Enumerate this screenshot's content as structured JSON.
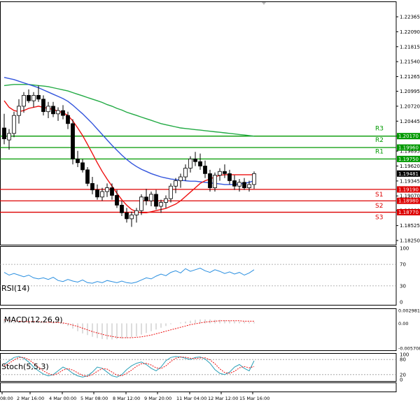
{
  "chart_data": {
    "type": "candlestick",
    "main": {
      "price_axis_ticks": [
        "1.22365",
        "1.22090",
        "1.21815",
        "1.21540",
        "1.21265",
        "1.20995",
        "1.20720",
        "1.20445",
        "1.20170",
        "1.19895",
        "1.19620",
        "1.19345",
        "1.19070",
        "1.18800",
        "1.18525",
        "1.18250"
      ],
      "x_ticks": [
        "08:00",
        "2 Mar 16:00",
        "4 Mar 00:00",
        "5 Mar 08:00",
        "8 Mar 12:00",
        "9 Mar 20:00",
        "11 Mar 04:00",
        "12 Mar 12:00",
        "15 Mar 16:00"
      ],
      "current_price": "1.19481",
      "levels": [
        {
          "name": "R3",
          "value": 1.2017,
          "label": "1.20170",
          "color": "#009900"
        },
        {
          "name": "R2",
          "value": 1.1996,
          "label": "1.19960",
          "color": "#009900"
        },
        {
          "name": "R1",
          "value": 1.1975,
          "label": "1.19750",
          "color": "#009900"
        },
        {
          "name": "S1",
          "value": 1.1919,
          "label": "1.19190",
          "color": "#dd0000"
        },
        {
          "name": "S2",
          "value": 1.1898,
          "label": "1.18980",
          "color": "#dd0000"
        },
        {
          "name": "S3",
          "value": 1.1877,
          "label": "1.18770",
          "color": "#dd0000"
        }
      ],
      "candles": [
        [
          1.2032,
          1.2058,
          1.2002,
          1.2012
        ],
        [
          1.201,
          1.203,
          1.1992,
          1.2022
        ],
        [
          1.2022,
          1.2062,
          1.2015,
          1.2055
        ],
        [
          1.2055,
          1.2085,
          1.204,
          1.2072
        ],
        [
          1.2072,
          1.2098,
          1.206,
          1.2092
        ],
        [
          1.2092,
          1.2103,
          1.2078,
          1.2082
        ],
        [
          1.2082,
          1.2098,
          1.207,
          1.2092
        ],
        [
          1.2092,
          1.211,
          1.208,
          1.2085
        ],
        [
          1.2085,
          1.2092,
          1.2055,
          1.2062
        ],
        [
          1.2062,
          1.208,
          1.205,
          1.2072
        ],
        [
          1.2072,
          1.208,
          1.2052,
          1.2058
        ],
        [
          1.2058,
          1.207,
          1.2045,
          1.2064
        ],
        [
          1.2064,
          1.2074,
          1.2048,
          1.2055
        ],
        [
          1.2055,
          1.2062,
          1.203,
          1.204
        ],
        [
          1.204,
          1.2048,
          1.1965,
          1.1975
        ],
        [
          1.1975,
          1.199,
          1.196,
          1.1968
        ],
        [
          1.1968,
          1.1975,
          1.195,
          1.1955
        ],
        [
          1.1955,
          1.196,
          1.1925,
          1.193
        ],
        [
          1.193,
          1.1942,
          1.191,
          1.1918
        ],
        [
          1.1918,
          1.1928,
          1.19,
          1.1905
        ],
        [
          1.1905,
          1.1922,
          1.1898,
          1.1915
        ],
        [
          1.1915,
          1.193,
          1.1905,
          1.1922
        ],
        [
          1.1922,
          1.193,
          1.19,
          1.1908
        ],
        [
          1.1908,
          1.1918,
          1.1885,
          1.189
        ],
        [
          1.189,
          1.1898,
          1.187,
          1.1876
        ],
        [
          1.1876,
          1.1885,
          1.1858,
          1.1865
        ],
        [
          1.1865,
          1.1878,
          1.185,
          1.1872
        ],
        [
          1.1872,
          1.1885,
          1.1858,
          1.188
        ],
        [
          1.188,
          1.191,
          1.1872,
          1.1905
        ],
        [
          1.1905,
          1.192,
          1.189,
          1.1898
        ],
        [
          1.1898,
          1.1915,
          1.1888,
          1.191
        ],
        [
          1.191,
          1.1918,
          1.1882,
          1.1888
        ],
        [
          1.1888,
          1.19,
          1.1876,
          1.1895
        ],
        [
          1.1895,
          1.1908,
          1.1885,
          1.1902
        ],
        [
          1.1902,
          1.193,
          1.1895,
          1.1925
        ],
        [
          1.1925,
          1.194,
          1.1912,
          1.1935
        ],
        [
          1.1935,
          1.1948,
          1.1922,
          1.1942
        ],
        [
          1.1942,
          1.1965,
          1.1935,
          1.1958
        ],
        [
          1.1958,
          1.198,
          1.195,
          1.1975
        ],
        [
          1.1975,
          1.1988,
          1.1962,
          1.197
        ],
        [
          1.197,
          1.1985,
          1.1955,
          1.1962
        ],
        [
          1.1962,
          1.1972,
          1.194,
          1.1948
        ],
        [
          1.1948,
          1.1955,
          1.1915,
          1.1922
        ],
        [
          1.1922,
          1.195,
          1.1915,
          1.1945
        ],
        [
          1.1945,
          1.1958,
          1.1935,
          1.1952
        ],
        [
          1.1952,
          1.1965,
          1.194,
          1.1948
        ],
        [
          1.1948,
          1.1955,
          1.1928,
          1.1935
        ],
        [
          1.1935,
          1.1945,
          1.1918,
          1.1925
        ],
        [
          1.1925,
          1.1938,
          1.1915,
          1.1932
        ],
        [
          1.1932,
          1.194,
          1.1918,
          1.1922
        ],
        [
          1.1922,
          1.1935,
          1.1915,
          1.1928
        ],
        [
          1.1928,
          1.1952,
          1.192,
          1.1948
        ]
      ],
      "ma_fast": [
        1.2082,
        1.207,
        1.2064,
        1.2062,
        1.2064,
        1.2068,
        1.207,
        1.2072,
        1.207,
        1.2068,
        1.2066,
        1.2063,
        1.206,
        1.2055,
        1.2045,
        1.2032,
        1.2018,
        1.2002,
        1.1985,
        1.1968,
        1.1952,
        1.1938,
        1.1925,
        1.1912,
        1.19,
        1.189,
        1.1882,
        1.1878,
        1.1876,
        1.1876,
        1.1878,
        1.188,
        1.1882,
        1.1884,
        1.1888,
        1.1892,
        1.1898,
        1.1906,
        1.1914,
        1.1922,
        1.193,
        1.1935,
        1.1938,
        1.1942,
        1.1945,
        1.1946,
        1.1946,
        1.1946,
        1.1946,
        1.1946,
        1.1946,
        1.1946
      ],
      "ma_mid": [
        1.2125,
        1.2123,
        1.2121,
        1.2118,
        1.2115,
        1.2112,
        1.2109,
        1.2106,
        1.2102,
        1.2098,
        1.2094,
        1.209,
        1.2086,
        1.2081,
        1.2074,
        1.2066,
        1.2058,
        1.2049,
        1.204,
        1.203,
        1.202,
        1.201,
        1.2,
        1.1991,
        1.1982,
        1.1974,
        1.1967,
        1.1961,
        1.1956,
        1.1952,
        1.1948,
        1.1945,
        1.1942,
        1.194,
        1.1938,
        1.1937,
        1.1936,
        1.1935,
        1.1934,
        1.1934,
        1.1933,
        1.1932,
        1.1931,
        1.193,
        1.1929,
        1.1928,
        1.1928,
        1.1928,
        1.1929,
        1.193,
        1.1932,
        1.1935
      ],
      "ma_slow": [
        1.211,
        1.2111,
        1.2112,
        1.2112,
        1.2112,
        1.2112,
        1.2111,
        1.211,
        1.2109,
        1.2108,
        1.2106,
        1.2104,
        1.2102,
        1.21,
        1.2097,
        1.2094,
        1.2091,
        1.2088,
        1.2085,
        1.2082,
        1.2079,
        1.2075,
        1.2072,
        1.2068,
        1.2065,
        1.2061,
        1.2058,
        1.2055,
        1.2052,
        1.2049,
        1.2046,
        1.2043,
        1.204,
        1.2038,
        1.2036,
        1.2034,
        1.2032,
        1.2031,
        1.203,
        1.2029,
        1.2028,
        1.2027,
        1.2026,
        1.2025,
        1.2024,
        1.2023,
        1.2022,
        1.2021,
        1.202,
        1.2019,
        1.2018,
        1.2017
      ]
    },
    "rsi": {
      "label": "RSI(14)",
      "ticks": [
        "100",
        "70",
        "30",
        "0"
      ],
      "values": [
        55,
        50,
        53,
        50,
        47,
        50,
        45,
        43,
        45,
        42,
        46,
        40,
        38,
        42,
        39,
        37,
        41,
        36,
        35,
        38,
        36,
        40,
        38,
        36,
        39,
        36,
        35,
        37,
        41,
        45,
        43,
        48,
        52,
        49,
        55,
        58,
        54,
        62,
        57,
        60,
        63,
        58,
        55,
        60,
        57,
        53,
        56,
        52,
        55,
        50,
        54,
        60
      ]
    },
    "macd": {
      "label": "MACD(12,26,9)",
      "ticks": [
        "0.002981",
        "0.00",
        "-0.005708"
      ],
      "histogram": [
        0.001,
        0.0006,
        0.0003,
        0.0002,
        0.0002,
        0.0003,
        0.0004,
        0.0003,
        0.0002,
        0.0001,
        0.0001,
        0.0,
        -0.0002,
        -0.0006,
        -0.0012,
        -0.0018,
        -0.0023,
        -0.0027,
        -0.0031,
        -0.0034,
        -0.0036,
        -0.0037,
        -0.0037,
        -0.0036,
        -0.0035,
        -0.0034,
        -0.0032,
        -0.003,
        -0.0026,
        -0.0022,
        -0.0018,
        -0.0014,
        -0.001,
        -0.0006,
        -0.0002,
        0.0,
        0.0002,
        0.0004,
        0.0006,
        0.0008,
        0.0009,
        0.0009,
        0.0009,
        0.0008,
        0.0008,
        0.0007,
        0.0006,
        0.0005,
        0.0004,
        0.0004,
        0.0003,
        0.0003
      ],
      "signal": [
        0.0008,
        0.0007,
        0.0006,
        0.0005,
        0.0004,
        0.0004,
        0.0004,
        0.0004,
        0.0003,
        0.0003,
        0.0002,
        0.0002,
        0.0001,
        -0.0001,
        -0.0004,
        -0.0007,
        -0.0011,
        -0.0015,
        -0.0019,
        -0.0022,
        -0.0025,
        -0.0028,
        -0.003,
        -0.0032,
        -0.0033,
        -0.0033,
        -0.0033,
        -0.0032,
        -0.0031,
        -0.0029,
        -0.0027,
        -0.0024,
        -0.0021,
        -0.0018,
        -0.0015,
        -0.0012,
        -0.0009,
        -0.0006,
        -0.0003,
        -0.0001,
        0.0001,
        0.0003,
        0.0004,
        0.0005,
        0.0006,
        0.0006,
        0.0006,
        0.0006,
        0.0006,
        0.0005,
        0.0005,
        0.0005
      ]
    },
    "stoch": {
      "label": "Stoch(5,5,3)",
      "ticks": [
        "100",
        "80",
        "20",
        "0"
      ],
      "main": [
        60,
        75,
        88,
        92,
        85,
        70,
        50,
        35,
        22,
        15,
        20,
        35,
        50,
        40,
        25,
        15,
        10,
        15,
        30,
        50,
        45,
        30,
        15,
        10,
        20,
        40,
        55,
        65,
        70,
        60,
        45,
        35,
        50,
        75,
        88,
        92,
        90,
        85,
        80,
        88,
        90,
        82,
        65,
        40,
        25,
        20,
        30,
        50,
        60,
        45,
        35,
        75
      ],
      "signal": [
        55,
        65,
        78,
        88,
        88,
        80,
        65,
        50,
        35,
        24,
        18,
        25,
        38,
        44,
        38,
        27,
        17,
        13,
        20,
        33,
        44,
        42,
        30,
        18,
        15,
        25,
        38,
        53,
        63,
        65,
        58,
        47,
        44,
        55,
        72,
        85,
        90,
        89,
        85,
        84,
        86,
        87,
        79,
        63,
        43,
        28,
        25,
        33,
        47,
        52,
        47,
        52
      ]
    }
  }
}
